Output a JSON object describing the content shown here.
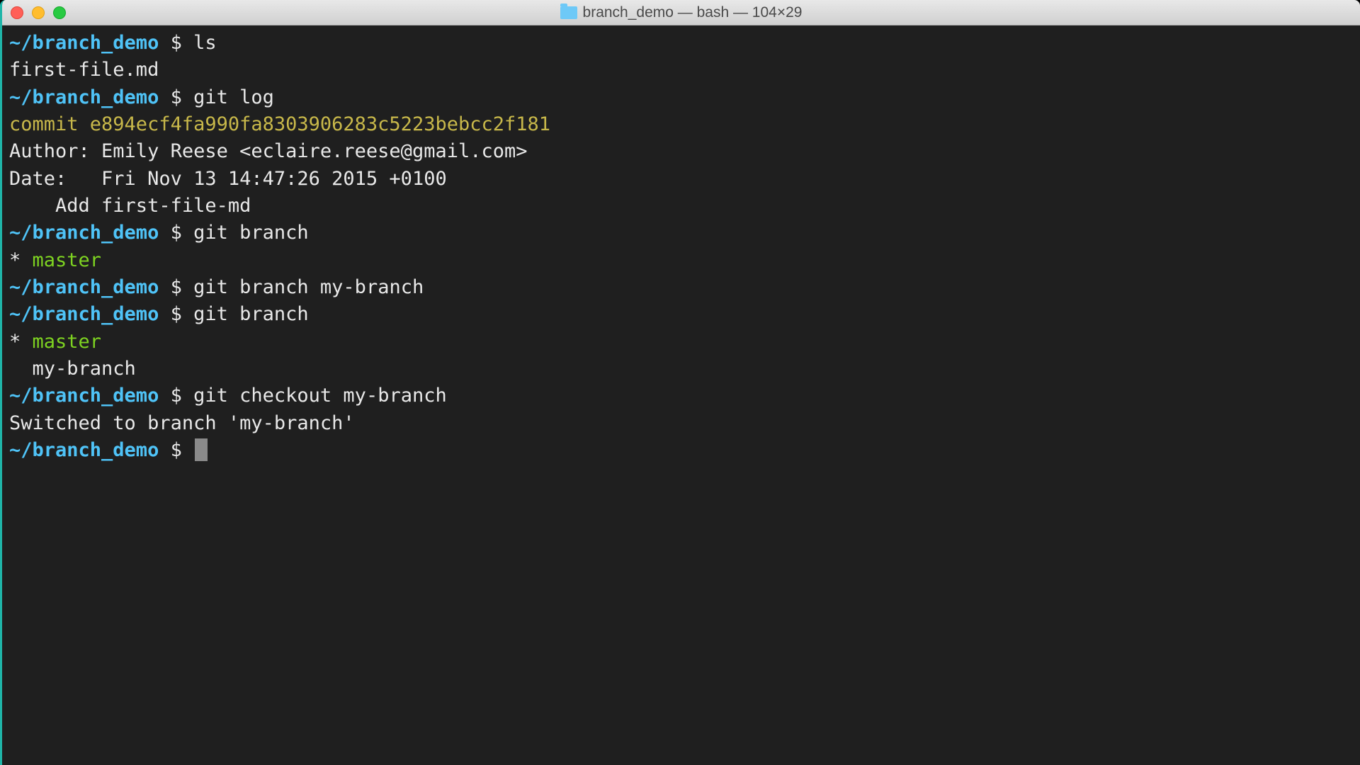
{
  "titlebar": {
    "title": "branch_demo — bash — 104×29"
  },
  "lines": {
    "l0_prompt": "~/branch_demo",
    "l0_dollar": " $ ",
    "l0_cmd": "ls",
    "l1": "first-file.md",
    "l2_prompt": "~/branch_demo",
    "l2_dollar": " $ ",
    "l2_cmd": "git log",
    "l3": "commit e894ecf4fa990fa8303906283c5223bebcc2f181",
    "l4": "Author: Emily Reese <eclaire.reese@gmail.com>",
    "l5": "Date:   Fri Nov 13 14:47:26 2015 +0100",
    "l6": "",
    "l7": "    Add first-file-md",
    "l8_prompt": "~/branch_demo",
    "l8_dollar": " $ ",
    "l8_cmd": "git branch",
    "l9_star": "* ",
    "l9_branch": "master",
    "l10_prompt": "~/branch_demo",
    "l10_dollar": " $ ",
    "l10_cmd": "git branch my-branch",
    "l11_prompt": "~/branch_demo",
    "l11_dollar": " $ ",
    "l11_cmd": "git branch",
    "l12_star": "* ",
    "l12_branch": "master",
    "l13": "  my-branch",
    "l14_prompt": "~/branch_demo",
    "l14_dollar": " $ ",
    "l14_cmd": "git checkout my-branch",
    "l15": "Switched to branch 'my-branch'",
    "l16_prompt": "~/branch_demo",
    "l16_dollar": " $ "
  }
}
